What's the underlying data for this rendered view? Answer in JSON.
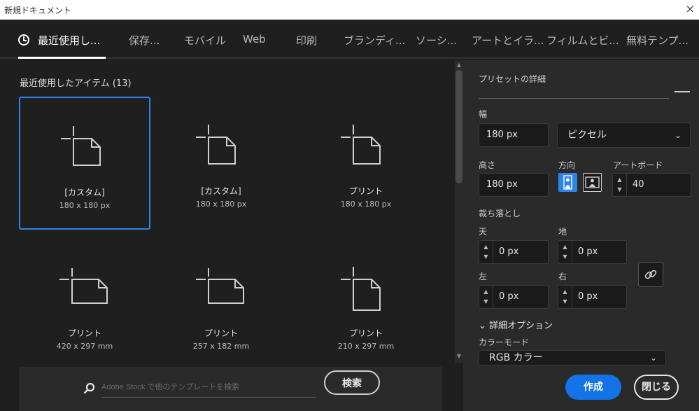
{
  "window": {
    "title": "新規ドキュメント",
    "close_glyph": "×"
  },
  "tabs": [
    {
      "label": "最近使用し...",
      "active": true,
      "icon": "clock-icon"
    },
    {
      "label": "保存..."
    },
    {
      "label": "モバイル"
    },
    {
      "label": "Web"
    },
    {
      "label": "印刷"
    },
    {
      "label": "ブランディ..."
    },
    {
      "label": "ソーシ..."
    },
    {
      "label": "アートとイラ..."
    },
    {
      "label": "フィルムとビ..."
    },
    {
      "label": "無料テンプ..."
    }
  ],
  "recent": {
    "title": "最近使用したアイテム (13)",
    "items": [
      {
        "name": "[カスタム]",
        "size": "180 x 180 px",
        "selected": true
      },
      {
        "name": "[カスタム]",
        "size": "180 x 180 px"
      },
      {
        "name": "プリント",
        "size": "180 x 180 px"
      },
      {
        "name": "プリント",
        "size": "420 x 297 mm"
      },
      {
        "name": "プリント",
        "size": "257 x 182 mm"
      },
      {
        "name": "プリント",
        "size": "210 x 297 mm"
      }
    ]
  },
  "search": {
    "placeholder": "Adobe Stock で他のテンプレートを検索",
    "button": "検索"
  },
  "details": {
    "header": "プリセットの詳細",
    "width_label": "幅",
    "width_value": "180 px",
    "unit": "ピクセル",
    "height_label": "高さ",
    "height_value": "180 px",
    "orientation_label": "方向",
    "artboard_label": "アートボード",
    "artboard_value": "40",
    "bleed_label": "裁ち落とし",
    "top_label": "天",
    "top_value": "0 px",
    "bottom_label": "地",
    "bottom_value": "0 px",
    "left_label": "左",
    "left_value": "0 px",
    "right_label": "右",
    "right_value": "0 px",
    "advanced_label": "詳細オプション",
    "color_mode_label": "カラーモード",
    "color_mode_value": "RGB カラー"
  },
  "buttons": {
    "create": "作成",
    "close": "閉じる"
  },
  "colors": {
    "accent": "#1473e6",
    "selection": "#2c86e8",
    "bg": "#1f1f1f",
    "panel": "#2a2a2a"
  }
}
